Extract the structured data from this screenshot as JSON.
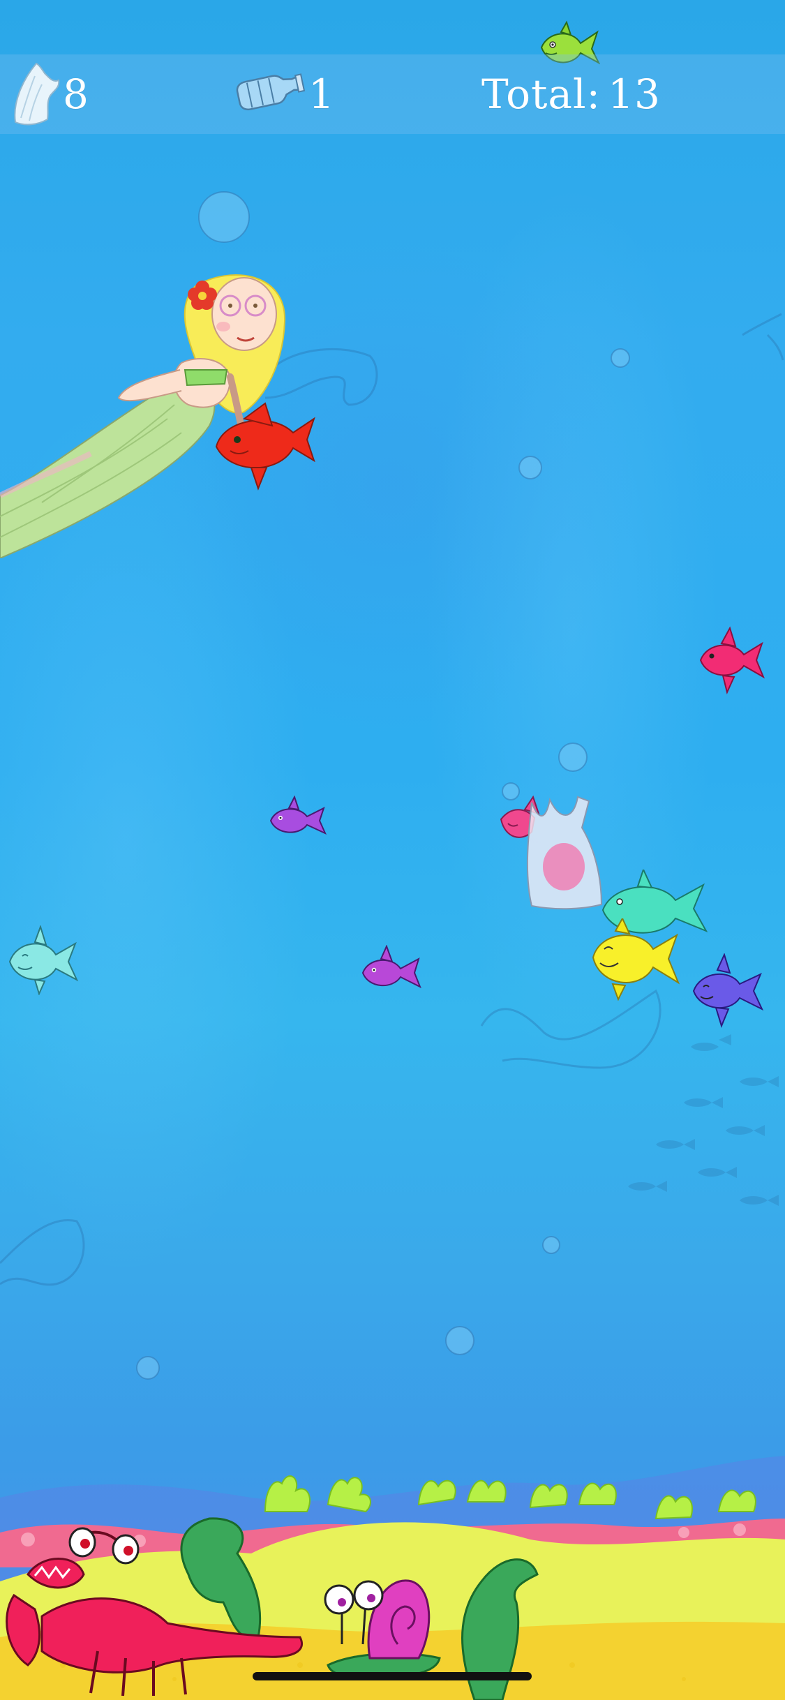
{
  "hud": {
    "shells_count": "8",
    "bottles_count": "1",
    "total_label": "Total:",
    "total_value": "13"
  },
  "icons": {
    "shells": "sea-shell-icon",
    "bottles": "plastic-bottle-icon",
    "mascot": "green-fish-icon"
  },
  "colors": {
    "water_top": "#2aa7e8",
    "water_bottom": "#4a92e6",
    "hud_bar": "#7cbef0",
    "hud_text": "#ffffff",
    "sand": "#f4d230",
    "seaweed": "#b6f046",
    "coral": "#f06a90"
  }
}
